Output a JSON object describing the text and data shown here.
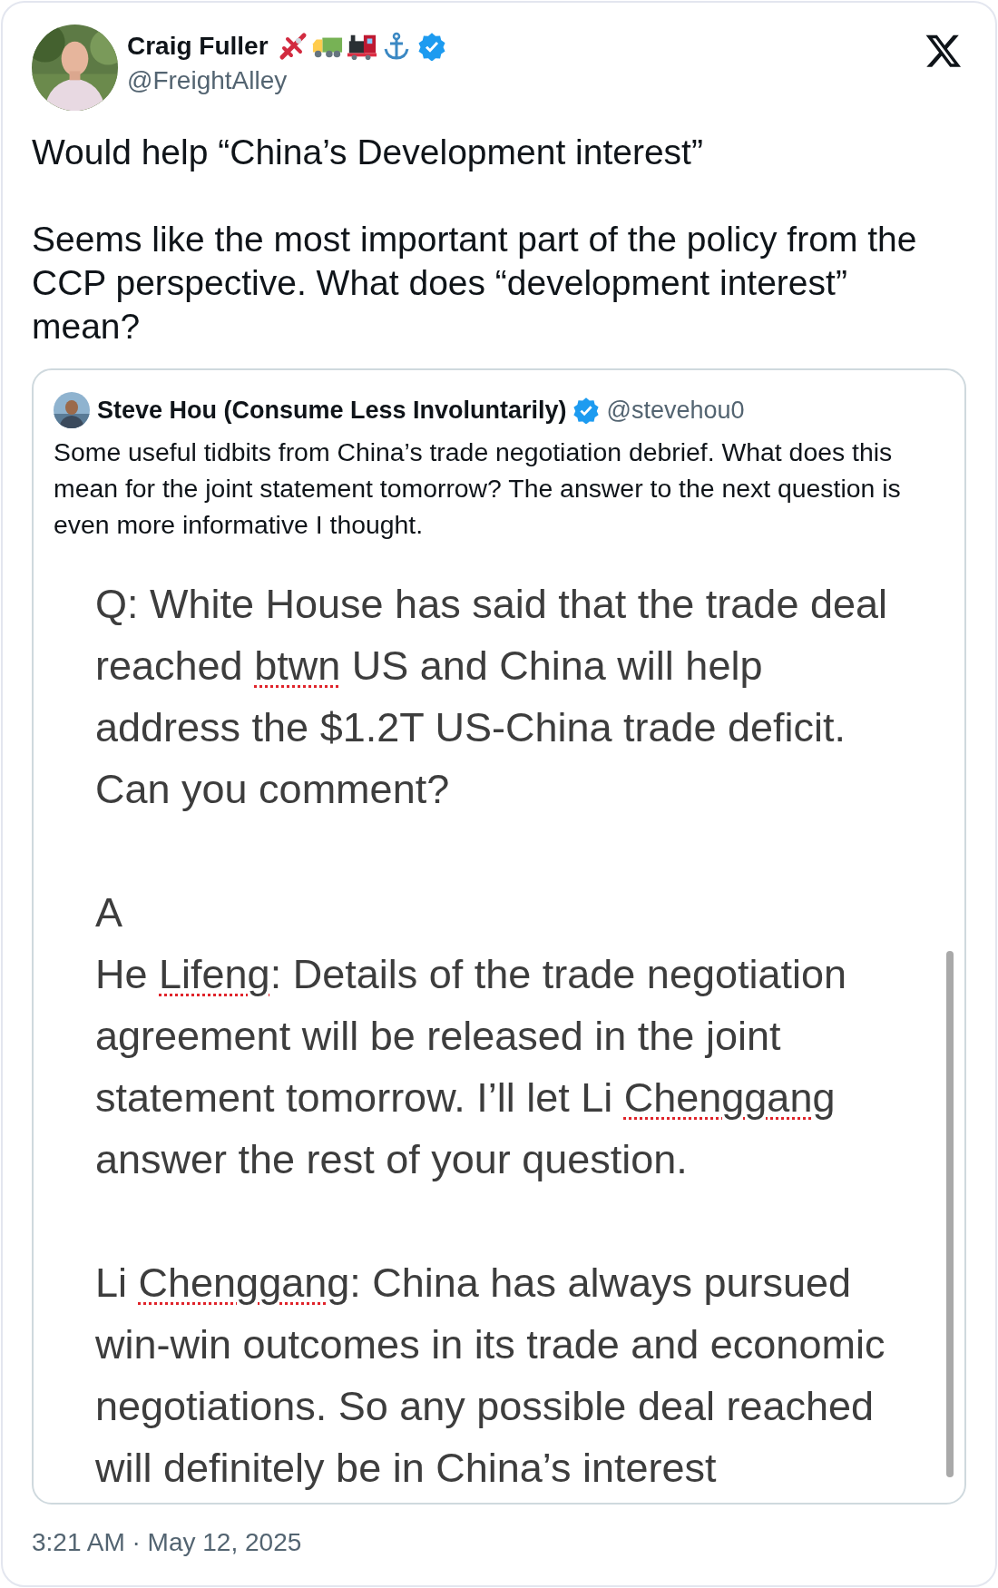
{
  "author": {
    "name": "Craig Fuller",
    "handle": "@FreightAlley",
    "verified": true
  },
  "body": [
    "Would help “China’s Development interest”",
    "Seems like the most important part of the policy from the CCP perspective. What does “development interest” mean?"
  ],
  "quote": {
    "author": "Steve Hou (Consume Less Involuntarily)",
    "verified": true,
    "handle": "@stevehou0",
    "text": "Some useful tidbits from China’s trade negotiation debrief. What does this mean for the joint statement tomorrow? The answer to the next question is even more informative I thought.",
    "image_text": [
      [
        [
          {
            "text": "Q: White House has said that the trade deal",
            "misspelled": false
          }
        ],
        [
          {
            "text": "reached ",
            "misspelled": false
          },
          {
            "text": "btwn",
            "misspelled": true
          },
          {
            "text": " US and China will help",
            "misspelled": false
          }
        ],
        [
          {
            "text": "address the $1.2T US-China trade deficit.",
            "misspelled": false
          }
        ],
        [
          {
            "text": "Can you comment?",
            "misspelled": false
          }
        ]
      ],
      [
        [
          {
            "text": "A",
            "misspelled": false
          }
        ],
        [
          {
            "text": "He ",
            "misspelled": false
          },
          {
            "text": "Lifeng",
            "misspelled": true
          },
          {
            "text": ": Details of the trade negotiation",
            "misspelled": false
          }
        ],
        [
          {
            "text": "agreement will be released in the joint",
            "misspelled": false
          }
        ],
        [
          {
            "text": "statement tomorrow. I’ll let Li ",
            "misspelled": false
          },
          {
            "text": "Chenggang",
            "misspelled": true
          }
        ],
        [
          {
            "text": "answer the rest of your question.",
            "misspelled": false
          }
        ]
      ],
      [
        [
          {
            "text": "Li ",
            "misspelled": false
          },
          {
            "text": "Chenggang",
            "misspelled": true
          },
          {
            "text": ": China has always pursued",
            "misspelled": false
          }
        ],
        [
          {
            "text": "win-win outcomes in its trade and economic",
            "misspelled": false
          }
        ],
        [
          {
            "text": "negotiations. So any possible deal reached",
            "misspelled": false
          }
        ],
        [
          {
            "text": "will definitely be in China’s interest",
            "misspelled": false
          }
        ]
      ]
    ]
  },
  "timestamp": "3:21 AM · May 12, 2025"
}
